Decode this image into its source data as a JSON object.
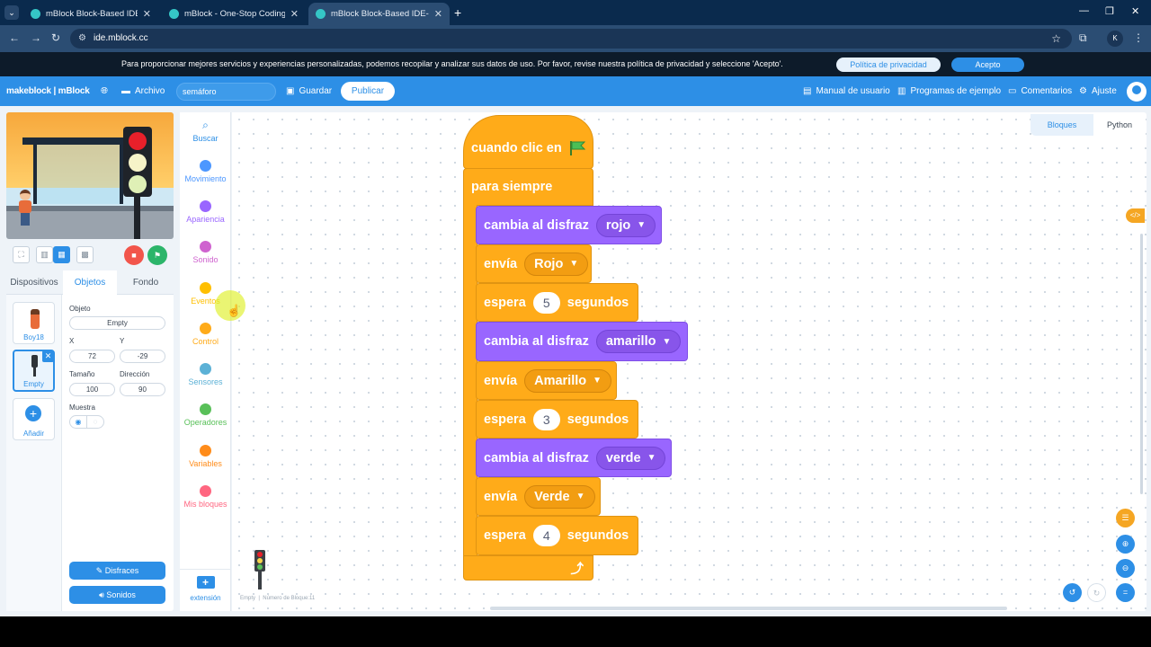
{
  "browser": {
    "tabs": [
      {
        "title": "mBlock Block-Based IDE- Codin"
      },
      {
        "title": "mBlock - One-Stop Coding Platf"
      },
      {
        "title": "mBlock Block-Based IDE- Codin"
      }
    ],
    "url": "ide.mblock.cc",
    "profile_initial": "K"
  },
  "cookie": {
    "message": "Para proporcionar mejores servicios y experiencias personalizadas, podemos recopilar y analizar sus datos de uso. Por favor, revise nuestra política de privacidad y seleccione 'Acepto'.",
    "policy_btn": "Política de privacidad",
    "accept_btn": "Acepto"
  },
  "header": {
    "logo": "makeblock | mBlock",
    "file": "Archivo",
    "project_name": "semáforo",
    "save": "Guardar",
    "publish": "Publicar",
    "manual": "Manual de usuario",
    "examples": "Programas de ejemplo",
    "feedback": "Comentarios",
    "settings": "Ajuste"
  },
  "sprite_panel": {
    "tabs": [
      "Dispositivos",
      "Objetos",
      "Fondo"
    ],
    "sprites": [
      {
        "name": "Boy18"
      },
      {
        "name": "Empty"
      }
    ],
    "add_label": "Añadir",
    "object_label": "Objeto",
    "object_value": "Empty",
    "x_label": "X",
    "x_value": "72",
    "y_label": "Y",
    "y_value": "-29",
    "size_label": "Tamaño",
    "size_value": "100",
    "dir_label": "Dirección",
    "dir_value": "90",
    "show_label": "Muestra",
    "costumes_btn": "Disfraces",
    "sounds_btn": "Sonidos"
  },
  "categories": [
    {
      "label": "Buscar",
      "color": "#2d8fe6"
    },
    {
      "label": "Movimiento",
      "color": "#4c97ff"
    },
    {
      "label": "Apariencia",
      "color": "#9966ff"
    },
    {
      "label": "Sonido",
      "color": "#cf63cf"
    },
    {
      "label": "Eventos",
      "color": "#ffbf00"
    },
    {
      "label": "Control",
      "color": "#ffab19"
    },
    {
      "label": "Sensores",
      "color": "#5cb1d6"
    },
    {
      "label": "Operadores",
      "color": "#59c059"
    },
    {
      "label": "Variables",
      "color": "#ff8c1a"
    },
    {
      "label": "Mis bloques",
      "color": "#ff6680"
    }
  ],
  "extension_label": "extensión",
  "editor_tabs": {
    "blocks": "Bloques",
    "python": "Python"
  },
  "status": {
    "sprite": "Empty",
    "block_count": "Número de Bloque:11"
  },
  "script": {
    "hat": "cuando clic en",
    "forever": "para siempre",
    "b1_text": "cambia al disfraz",
    "b1_value": "rojo",
    "b2_text": "envía",
    "b2_value": "Rojo",
    "b3_text": "espera",
    "b3_num": "5",
    "b3_unit": "segundos",
    "b4_text": "cambia al disfraz",
    "b4_value": "amarillo",
    "b5_text": "envía",
    "b5_value": "Amarillo",
    "b6_text": "espera",
    "b6_num": "3",
    "b6_unit": "segundos",
    "b7_text": "cambia al disfraz",
    "b7_value": "verde",
    "b8_text": "envía",
    "b8_value": "Verde",
    "b9_text": "espera",
    "b9_num": "4",
    "b9_unit": "segundos"
  },
  "colors": {
    "accent": "#2d8fe6",
    "events": "#ffab19",
    "looks": "#9966ff"
  }
}
